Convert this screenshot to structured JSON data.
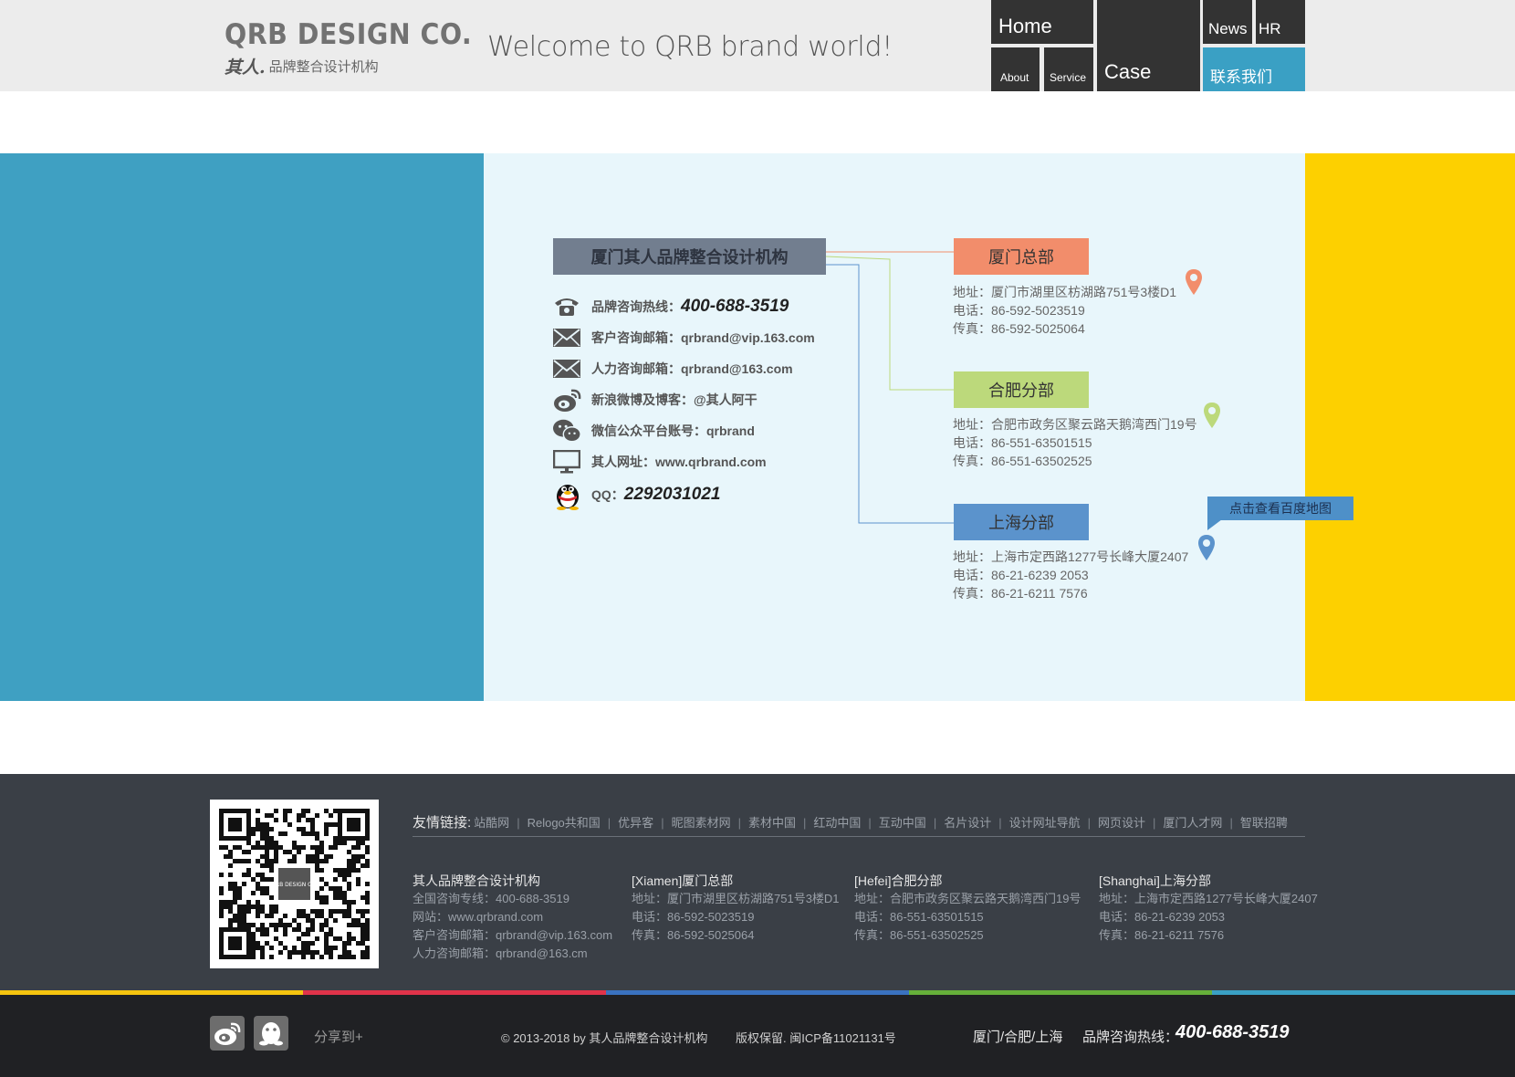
{
  "header": {
    "logo_main": "QRB DESIGN CO.",
    "logo_sign": "其人.",
    "logo_sub": "品牌整合设计机构",
    "welcome": "Welcome to QRB brand world!"
  },
  "nav": {
    "home": "Home",
    "about": "About",
    "service": "Service",
    "case": "Case",
    "news": "News",
    "hr": "HR",
    "contact": "联系我们"
  },
  "org": {
    "title": "厦门其人品牌整合设计机构",
    "hotline_label": "品牌咨询热线：",
    "hotline": "400-688-3519",
    "client_email": "客户咨询邮箱：qrbrand@vip.163.com",
    "hr_email": "人力咨询邮箱：qrbrand@163.com",
    "weibo": "新浪微博及博客：@其人阿干",
    "wechat": "微信公众平台账号：qrbrand",
    "website": "其人网址：www.qrbrand.com",
    "qq_label": "QQ：",
    "qq": "2292031021"
  },
  "branches": {
    "xiamen": {
      "name": "厦门总部",
      "address": "地址：厦门市湖里区枋湖路751号3楼D1",
      "phone": "电话：86-592-5023519",
      "fax": "传真：86-592-5025064",
      "color": "#f28d6b"
    },
    "hefei": {
      "name": "合肥分部",
      "address": "地址：合肥市政务区聚云路天鹅湾西门19号",
      "phone": "电话：86-551-63501515",
      "fax": "传真：86-551-63502525",
      "color": "#bcd97b"
    },
    "shanghai": {
      "name": "上海分部",
      "address": "地址：上海市定西路1277号长峰大厦2407",
      "phone": "电话：86-21-6239 2053",
      "fax": "传真：86-21-6211 7576",
      "color": "#5b93cc"
    },
    "map_link": "点击查看百度地图"
  },
  "footer": {
    "links_label": "友情链接:",
    "links": [
      "站酷网",
      "Relogo共和国",
      "优异客",
      "昵图素材网",
      "素材中国",
      "红动中国",
      "互动中国",
      "名片设计",
      "设计网址导航",
      "网页设计",
      "厦门人才网",
      "智联招聘"
    ],
    "col_org": {
      "title": "其人品牌整合设计机构",
      "l1": "全国咨询专线：400-688-3519",
      "l2": "网站：www.qrbrand.com",
      "l3": "客户咨询邮箱：qrbrand@vip.163.com",
      "l4": "人力咨询邮箱：qrbrand@163.cm"
    },
    "col_xiamen": {
      "title": "[Xiamen]厦门总部",
      "l1": "地址：厦门市湖里区枋湖路751号3楼D1",
      "l2": "电话：86-592-5023519",
      "l3": "传真：86-592-5025064"
    },
    "col_hefei": {
      "title": "[Hefei]合肥分部",
      "l1": "地址：合肥市政务区聚云路天鹅湾西门19号",
      "l2": "电话：86-551-63501515",
      "l3": "传真：86-551-63502525"
    },
    "col_shanghai": {
      "title": "[Shanghai]上海分部",
      "l1": "地址：上海市定西路1277号长峰大厦2407",
      "l2": "电话：86-21-6239 2053",
      "l3": "传真：86-21-6211 7576"
    },
    "qr_logo_text": "QRB DESIGN CO."
  },
  "bottom": {
    "share": "分享到+",
    "copyright": "© 2013-2018 by 其人品牌整合设计机构",
    "icp": "版权保留. 闽ICP备11021131号",
    "cities": "厦门/合肥/上海",
    "hotline_label": "品牌咨询热线：",
    "hotline": "400-688-3519"
  },
  "colors": {
    "accent_blue": "#3fa0c2",
    "accent_yellow": "#fdd000",
    "stripe": [
      "#f5c40f",
      "#e0334a",
      "#3a72c0",
      "#66b03a",
      "#3aa0c4"
    ]
  },
  "icons": [
    "phone-icon",
    "envelope-icon",
    "weibo-icon",
    "wechat-icon",
    "monitor-icon",
    "qq-penguin-icon",
    "map-pin-icon",
    "qr-code"
  ]
}
